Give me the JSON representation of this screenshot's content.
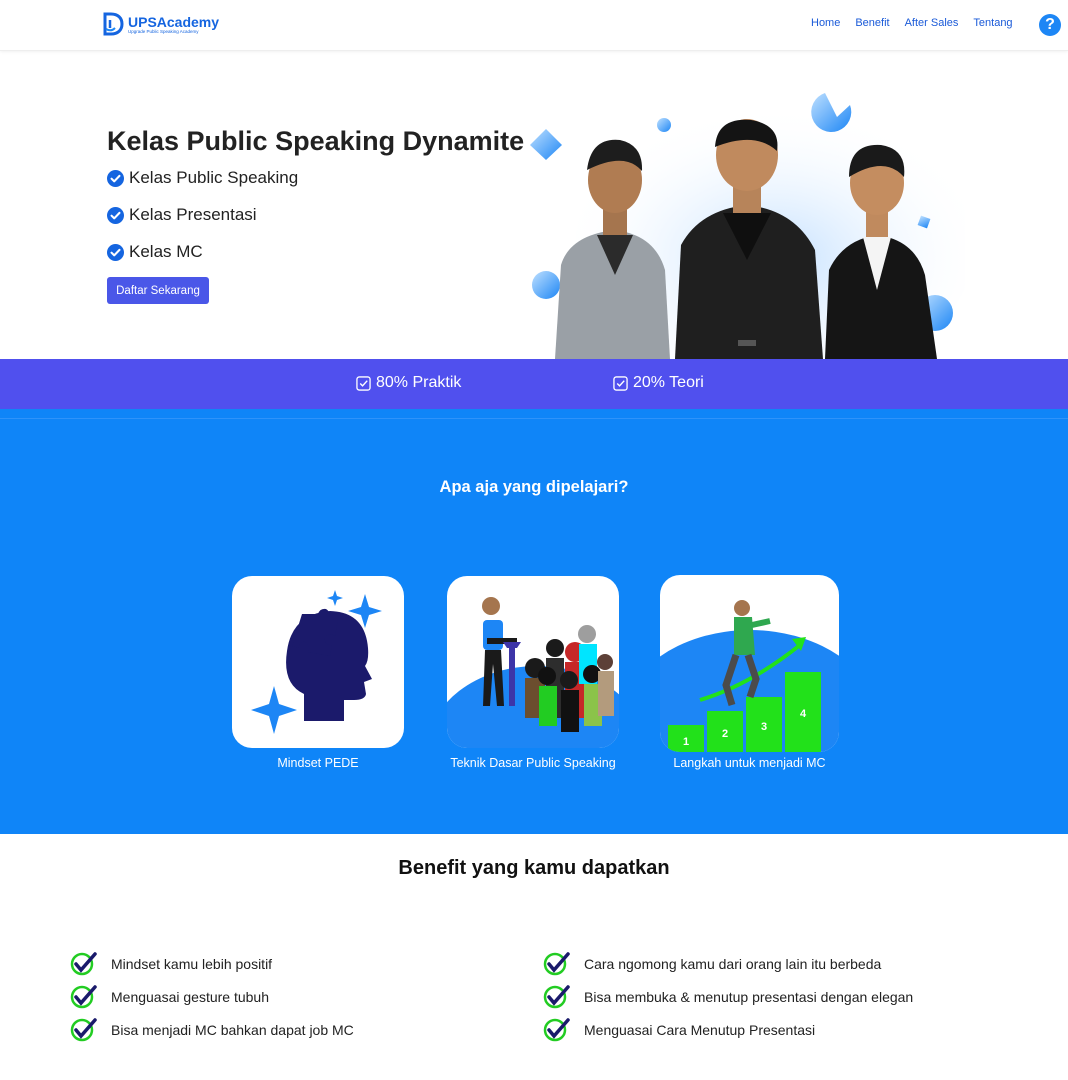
{
  "brand": {
    "name": "UPSAcademy",
    "tagline": "Upgrade Public Speaking Academy",
    "primary_color": "#1565e0"
  },
  "nav": {
    "items": [
      "Home",
      "Benefit",
      "After Sales",
      "Tentang"
    ],
    "help_icon": "question-circle-icon",
    "help_glyph": "?"
  },
  "hero": {
    "title": "Kelas Public Speaking Dynamite",
    "features": [
      "Kelas Public Speaking",
      "Kelas Presentasi",
      "Kelas MC"
    ],
    "cta_label": "Daftar Sekarang",
    "cta_color": "#4a57e8"
  },
  "stats": [
    "80% Praktik",
    "20% Teori"
  ],
  "learn": {
    "title": "Apa aja yang dipelajari?",
    "cards": [
      {
        "label": "Mindset PEDE",
        "icon": "head-puzzle-icon"
      },
      {
        "label": "Teknik Dasar Public Speaking",
        "icon": "speaker-audience-icon"
      },
      {
        "label": "Langkah untuk menjadi MC",
        "icon": "climbing-steps-icon",
        "steps": [
          "1",
          "2",
          "3",
          "4"
        ]
      }
    ]
  },
  "benefits": {
    "title": "Benefit yang kamu dapatkan",
    "left": [
      "Mindset kamu lebih positif",
      "Menguasai gesture tubuh",
      "Bisa menjadi MC bahkan dapat job MC"
    ],
    "right": [
      "Cara ngomong kamu dari orang lain itu berbeda",
      "Bisa membuka & menutup presentasi dengan elegan",
      "Menguasai Cara Menutup Presentasi"
    ]
  },
  "colors": {
    "section_blue": "#0f85f8",
    "strip_purple": "#5050ee",
    "check_green": "#22cc22"
  }
}
